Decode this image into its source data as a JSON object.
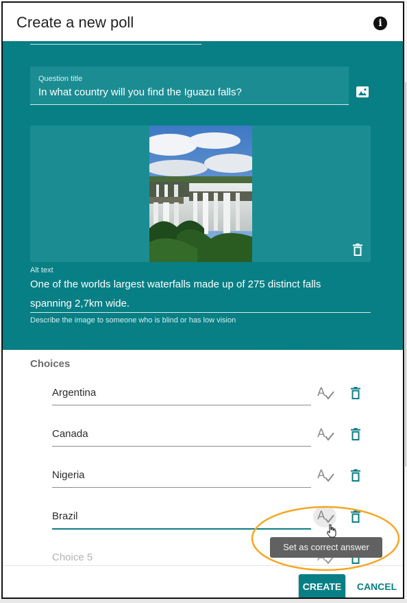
{
  "dialog": {
    "title": "Create a new poll"
  },
  "question": {
    "label": "Question title",
    "value": "In what country will you find the Iguazu falls?"
  },
  "image": {
    "alt_label": "Alt text",
    "alt_value": "One of the worlds largest waterfalls made up of 275 distinct falls spanning 2,7km wide.",
    "alt_help": "Describe the image to someone who is blind or has low vision"
  },
  "choices": {
    "title": "Choices",
    "items": [
      {
        "value": "Argentina"
      },
      {
        "value": "Canada"
      },
      {
        "value": "Nigeria"
      },
      {
        "value": "Brazil"
      }
    ],
    "placeholder": "Choice 5"
  },
  "tooltip": {
    "text": "Set as correct answer"
  },
  "footer": {
    "create": "CREATE",
    "cancel": "CANCEL"
  },
  "colors": {
    "primary": "#077f85",
    "panel": "#1b8d92",
    "highlight": "#f5a623"
  },
  "icons": [
    "info-icon",
    "image-icon",
    "trash-icon",
    "spellcheck-icon",
    "hand-cursor-icon"
  ]
}
